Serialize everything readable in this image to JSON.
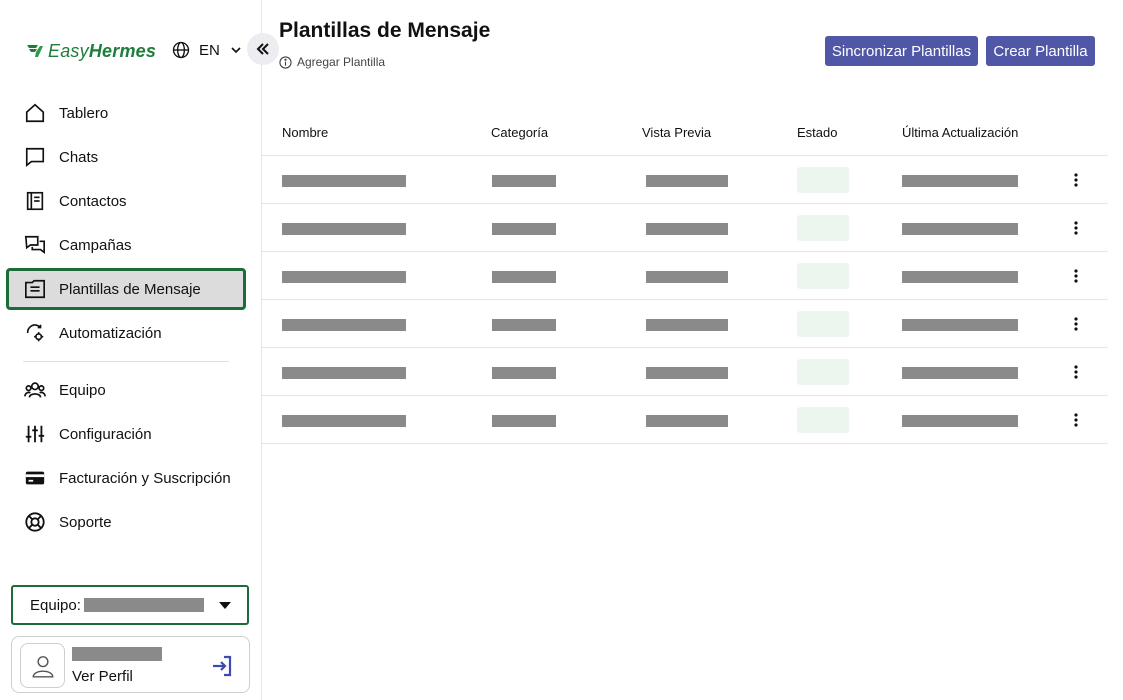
{
  "brand": {
    "name_part1": "Easy",
    "name_part2": "Hermes",
    "color": "#1e7d3a"
  },
  "language": {
    "current": "EN"
  },
  "sidebar": {
    "items": [
      {
        "label": "Tablero",
        "icon": "home-icon"
      },
      {
        "label": "Chats",
        "icon": "chat-icon"
      },
      {
        "label": "Contactos",
        "icon": "contacts-icon"
      },
      {
        "label": "Campañas",
        "icon": "campaigns-icon"
      },
      {
        "label": "Plantillas de Mensaje",
        "icon": "template-icon",
        "active": true
      },
      {
        "label": "Automatización",
        "icon": "automation-icon"
      },
      {
        "label": "Equipo",
        "icon": "team-icon"
      },
      {
        "label": "Configuración",
        "icon": "sliders-icon"
      },
      {
        "label": "Facturación y Suscripción",
        "icon": "credit-card-icon"
      },
      {
        "label": "Soporte",
        "icon": "lifebuoy-icon"
      }
    ],
    "team_label": "Equipo:",
    "profile_link": "Ver Perfil"
  },
  "header": {
    "title": "Plantillas de Mensaje",
    "subtitle": "Agregar Plantilla",
    "sync_button": "Sincronizar Plantillas",
    "create_button": "Crear Plantilla",
    "button_color": "#4f57a6"
  },
  "table": {
    "columns": [
      "Nombre",
      "Categoría",
      "Vista Previa",
      "Estado",
      "Última Actualización"
    ],
    "row_count": 6
  },
  "colors": {
    "active_border": "#1e6b3a",
    "status_pill": "#edf5ef",
    "redacted": "#8a8a8a"
  }
}
